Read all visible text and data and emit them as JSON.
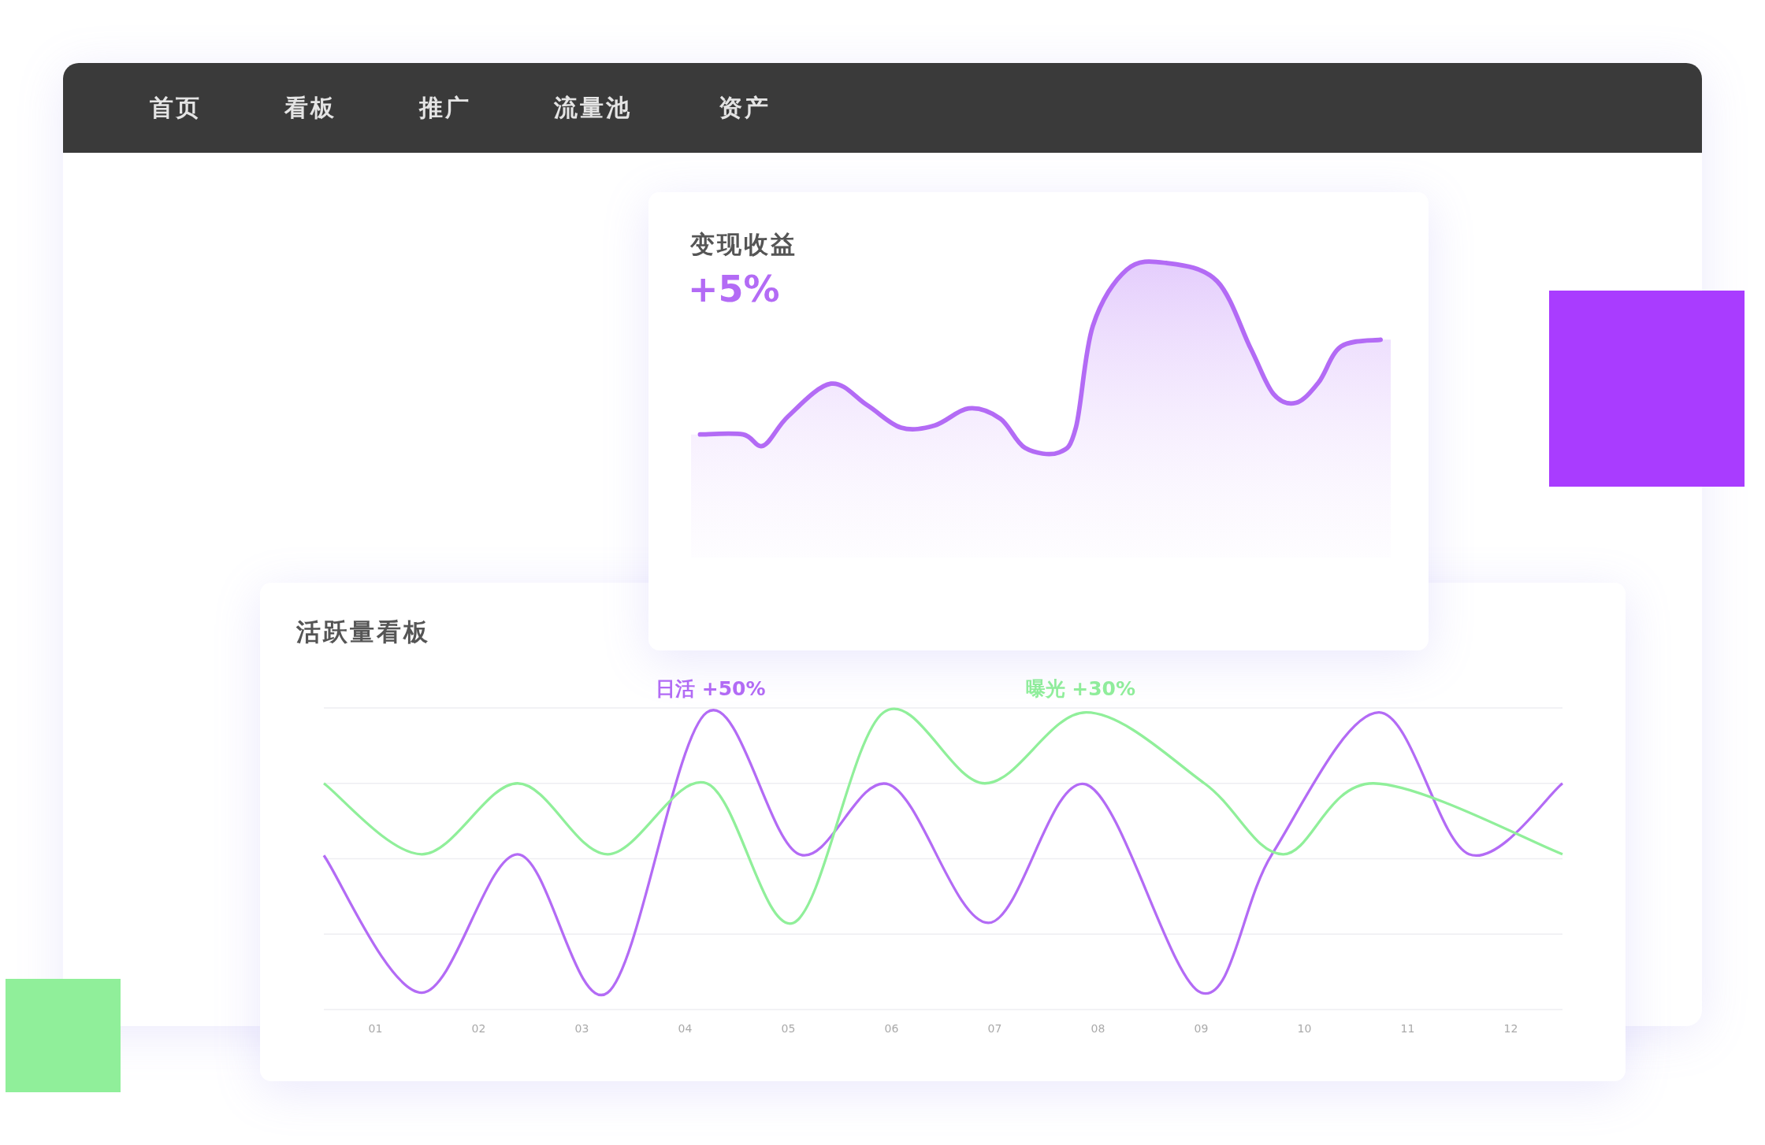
{
  "nav": {
    "items": [
      "首页",
      "看板",
      "推广",
      "流量池",
      "资产"
    ]
  },
  "revenue_card": {
    "title": "变现收益",
    "change": "+5%"
  },
  "activity_card": {
    "title": "活跃量看板",
    "legend": [
      {
        "label": "日活 +50%",
        "color": "#b36bf5"
      },
      {
        "label": "曝光 +30%",
        "color": "#90ef9a"
      }
    ],
    "x_labels": [
      "01",
      "02",
      "03",
      "04",
      "05",
      "06",
      "07",
      "08",
      "09",
      "10",
      "11",
      "12"
    ]
  }
}
